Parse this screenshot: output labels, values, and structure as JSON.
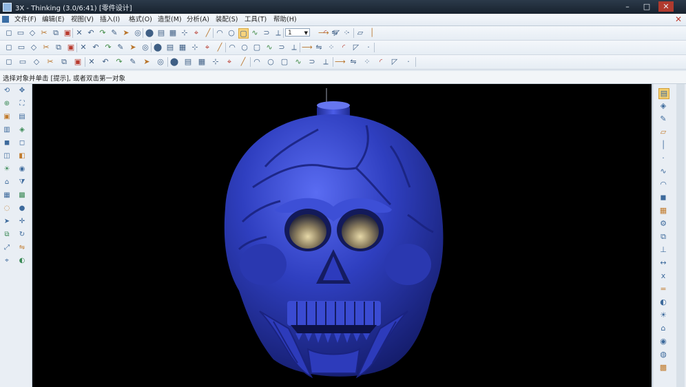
{
  "window": {
    "title": "3X - Thinking (3.0/6:41) [零件设计]",
    "controls": [
      "–",
      "□",
      "✕"
    ]
  },
  "menubar": {
    "items": [
      "文件(F)",
      "编辑(E)",
      "视图(V)",
      "插入(I)",
      "格式(O)",
      "造型(M)",
      "分析(A)",
      "装配(S)",
      "工具(T)",
      "帮助(H)"
    ],
    "close": "✕"
  },
  "toolbar": {
    "layer_value": "1",
    "row1_icons": [
      "new-icon",
      "open-icon",
      "save-icon",
      "cut-icon",
      "copy-icon",
      "paste-icon",
      "delete-icon",
      "undo-icon",
      "redo-icon",
      "pencil-icon",
      "select-icon",
      "view-icon",
      "render-icon",
      "layer-icon",
      "grid-icon",
      "snap-icon",
      "measure-icon",
      "line-icon",
      "arc-icon",
      "circle-icon",
      "rect-icon",
      "curve-icon",
      "offset-icon",
      "trim-icon",
      "extend-icon",
      "mirror-icon",
      "array-icon",
      "fillet-icon",
      "chamfer-icon",
      "point-icon",
      "plane-icon",
      "axis-icon"
    ],
    "row2_icons": [
      "box-icon",
      "sphere-icon",
      "cylinder-icon",
      "cone-icon",
      "torus-icon",
      "extrude-icon",
      "revolve-icon",
      "sweep-icon",
      "loft-icon",
      "blend-icon",
      "shell-icon",
      "draft-icon",
      "hole-icon",
      "rib-icon",
      "boolean-icon",
      "split-icon",
      "patch-icon",
      "surface-icon",
      "sew-icon",
      "thicken-icon",
      "fill-icon",
      "face-icon",
      "edge-icon",
      "vertex-icon",
      "move-icon",
      "rotate-icon",
      "scale-icon",
      "align-icon",
      "section-icon",
      "zoom-icon"
    ],
    "row3_icons": [
      "curve-line-icon",
      "curve-arc-icon",
      "spline-icon",
      "polyline-icon",
      "helix-icon",
      "project-icon",
      "intersect-icon",
      "offset-curve-icon",
      "fillet-curve-icon",
      "bridge-icon",
      "isoparm-icon",
      "wrap-icon",
      "edit-pt-icon",
      "control-icon",
      "rebuild-icon",
      "smooth-icon",
      "join-icon",
      "break-icon",
      "reverse-icon",
      "extend-curve-icon",
      "silhouette-icon",
      "outline-icon",
      "pipe-icon",
      "text-icon",
      "dim-icon",
      "note-icon",
      "tag-icon",
      "hatch-icon",
      "symbol-icon",
      "table-icon"
    ]
  },
  "status": {
    "prompt": "选择对象并单击 [提示], 或者双击第一对象"
  },
  "left_panel": {
    "icons": [
      "orbit-icon",
      "pan-icon",
      "zoom-icon",
      "fit-icon",
      "front-icon",
      "top-icon",
      "right-icon",
      "iso-icon",
      "shade-icon",
      "wire-icon",
      "hidden-icon",
      "section-icon",
      "light-icon",
      "material-icon",
      "camera-icon",
      "filter-icon",
      "layer-icon",
      "group-icon",
      "hide-icon",
      "show-icon",
      "select-icon",
      "move-icon",
      "copy-icon",
      "rotate-icon",
      "scale-icon",
      "mirror-icon",
      "measure-icon",
      "color-icon"
    ]
  },
  "right_panel": {
    "icons": [
      "history-icon",
      "feature-icon",
      "sketch-icon",
      "plane-icon",
      "axis-icon",
      "point-icon",
      "curve-icon",
      "surface-icon",
      "solid-icon",
      "mesh-icon",
      "part-icon",
      "assembly-icon",
      "constraint-icon",
      "dimension-icon",
      "variable-icon",
      "equation-icon",
      "display-icon",
      "light-icon",
      "camera-icon",
      "render-icon",
      "material-icon",
      "texture-icon"
    ]
  },
  "model": {
    "name": "skull-model",
    "color": "#2f3fc0"
  },
  "colors": {
    "viewport_bg": "#000000",
    "model_blue": "#2f3fc0",
    "model_highlight": "#6b7cf0",
    "eye_gold": "#b8a46a"
  }
}
